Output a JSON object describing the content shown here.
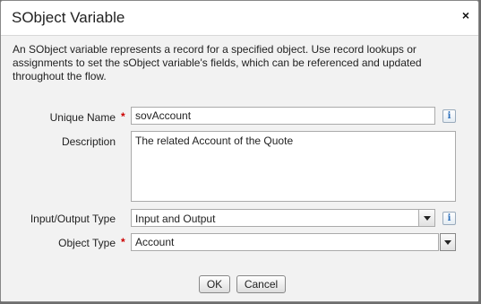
{
  "dialog": {
    "title": "SObject Variable",
    "close_glyph": "×",
    "description": "An SObject variable represents a record for a specified object. Use record lookups or assignments to set the sObject variable's fields, which can be referenced and updated throughout the flow."
  },
  "form": {
    "unique_name": {
      "label": "Unique Name",
      "required_marker": "*",
      "value": "sovAccount",
      "info_glyph": "i"
    },
    "description": {
      "label": "Description",
      "value": "The related Account of the Quote"
    },
    "io_type": {
      "label": "Input/Output Type",
      "selected": "Input and Output",
      "info_glyph": "i"
    },
    "object_type": {
      "label": "Object Type",
      "required_marker": "*",
      "value": "Account"
    }
  },
  "buttons": {
    "ok_label": "OK",
    "cancel_label": "Cancel"
  },
  "icons": {
    "close": "close-icon",
    "info": "info-icon",
    "dropdown": "chevron-down-icon"
  },
  "colors": {
    "required": "#cc0000",
    "info_accent": "#2a6ebb"
  }
}
